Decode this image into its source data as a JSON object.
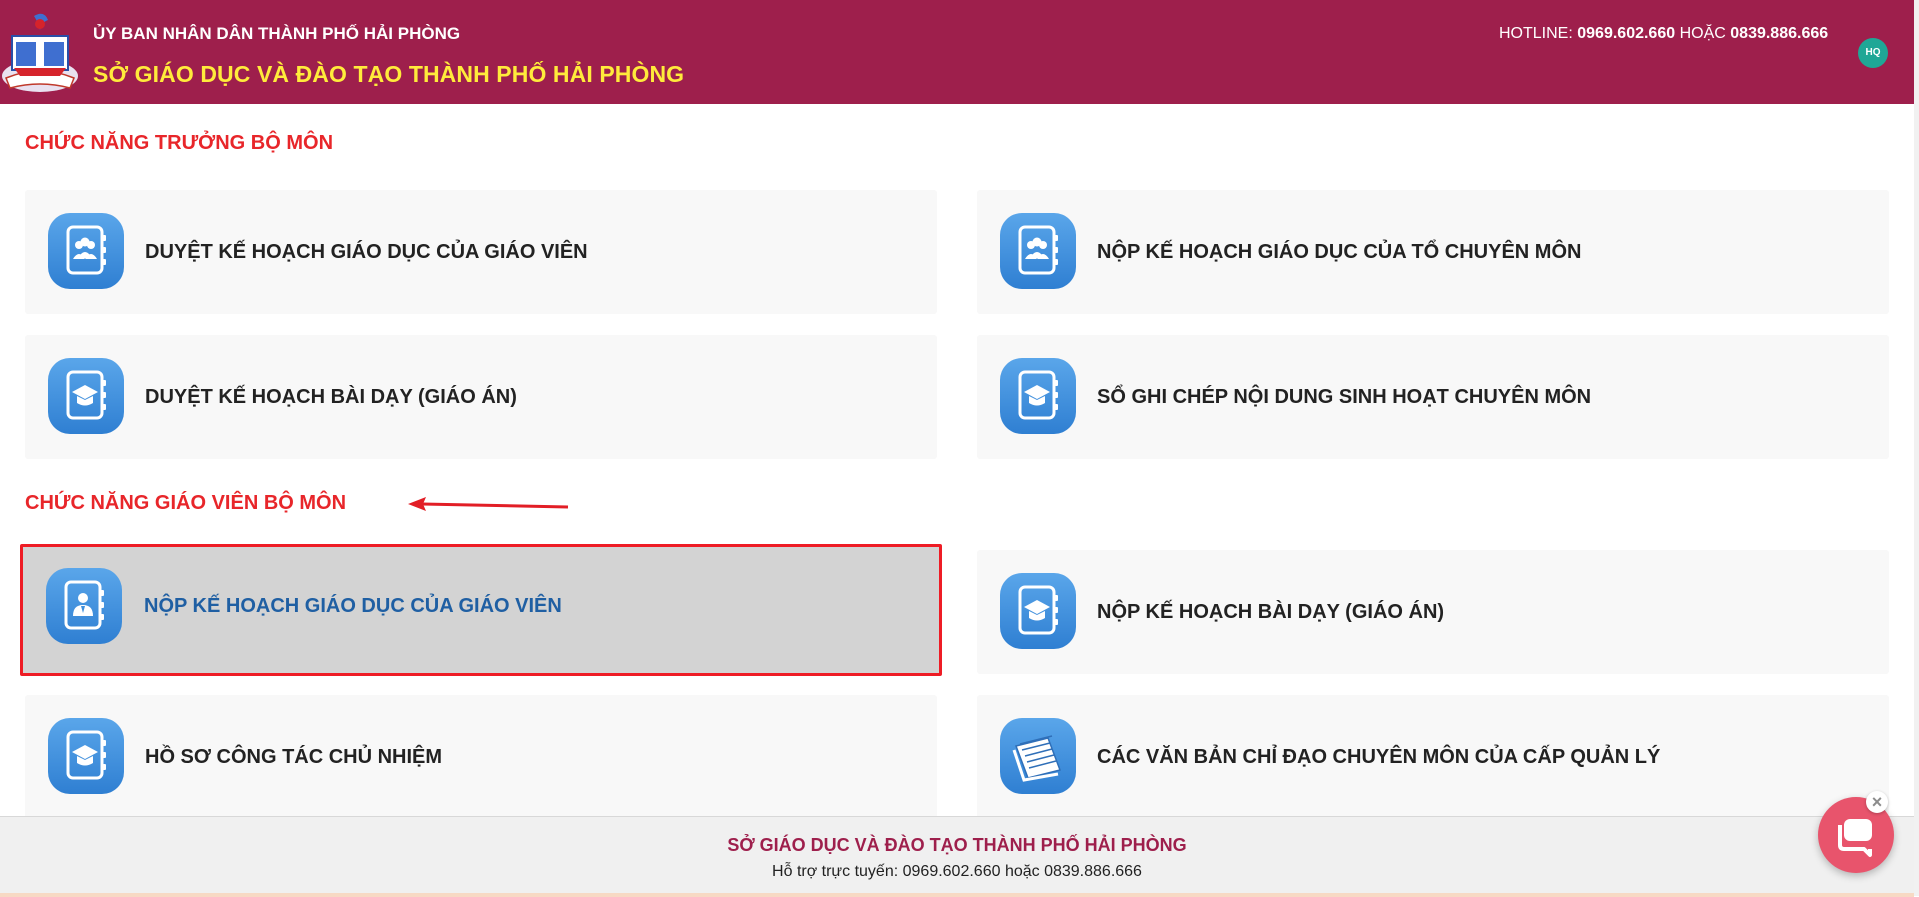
{
  "header": {
    "org_name": "ỦY BAN NHÂN DÂN THÀNH PHỐ HẢI PHÒNG",
    "department": "SỞ GIÁO DỤC VÀ ĐÀO TẠO THÀNH PHỐ HẢI PHÒNG",
    "hotline_label": "HOTLINE:",
    "hotline_1": "0969.602.660",
    "hotline_or": "HOẶC",
    "hotline_2": "0839.886.666",
    "avatar_initials": "HQ"
  },
  "sections": [
    {
      "title": "CHỨC NĂNG TRƯỞNG BỘ MÔN",
      "items": [
        {
          "label": "DUYỆT KẾ HOẠCH GIÁO DỤC CỦA GIÁO VIÊN",
          "icon": "people-notebook-icon"
        },
        {
          "label": "NỘP KẾ HOẠCH GIÁO DỤC CỦA TỔ CHUYÊN MÔN",
          "icon": "people-notebook-icon"
        },
        {
          "label": "DUYỆT KẾ HOẠCH BÀI DẠY (GIÁO ÁN)",
          "icon": "graduation-notebook-icon"
        },
        {
          "label": "SỔ GHI CHÉP NỘI DUNG SINH HOẠT CHUYÊN MÔN",
          "icon": "graduation-notebook-icon"
        }
      ]
    },
    {
      "title": "CHỨC NĂNG GIÁO VIÊN BỘ MÔN",
      "items": [
        {
          "label": "NỘP KẾ HOẠCH GIÁO DỤC CỦA GIÁO VIÊN",
          "icon": "teacher-notebook-icon",
          "highlighted": true
        },
        {
          "label": "NỘP KẾ HOẠCH BÀI DẠY (GIÁO ÁN)",
          "icon": "graduation-notebook-icon"
        },
        {
          "label": "HỒ SƠ CÔNG TÁC CHỦ NHIỆM",
          "icon": "graduation-notebook-icon"
        },
        {
          "label": "CÁC VĂN BẢN CHỈ ĐẠO CHUYÊN MÔN CỦA CẤP QUẢN LÝ",
          "icon": "documents-icon"
        }
      ]
    }
  ],
  "footer": {
    "title": "SỞ GIÁO DỤC VÀ ĐÀO TẠO THÀNH PHỐ HẢI PHÒNG",
    "support": "Hỗ trợ trực tuyến: 0969.602.660 hoặc 0839.886.666"
  },
  "colors": {
    "header_bg": "#9e1f4c",
    "header_title": "#ffeb3b",
    "section_title": "#e8262a",
    "icon_blue": "#3f8fdc",
    "highlight_border": "#ee1c25",
    "highlight_text": "#1f5fa3"
  }
}
